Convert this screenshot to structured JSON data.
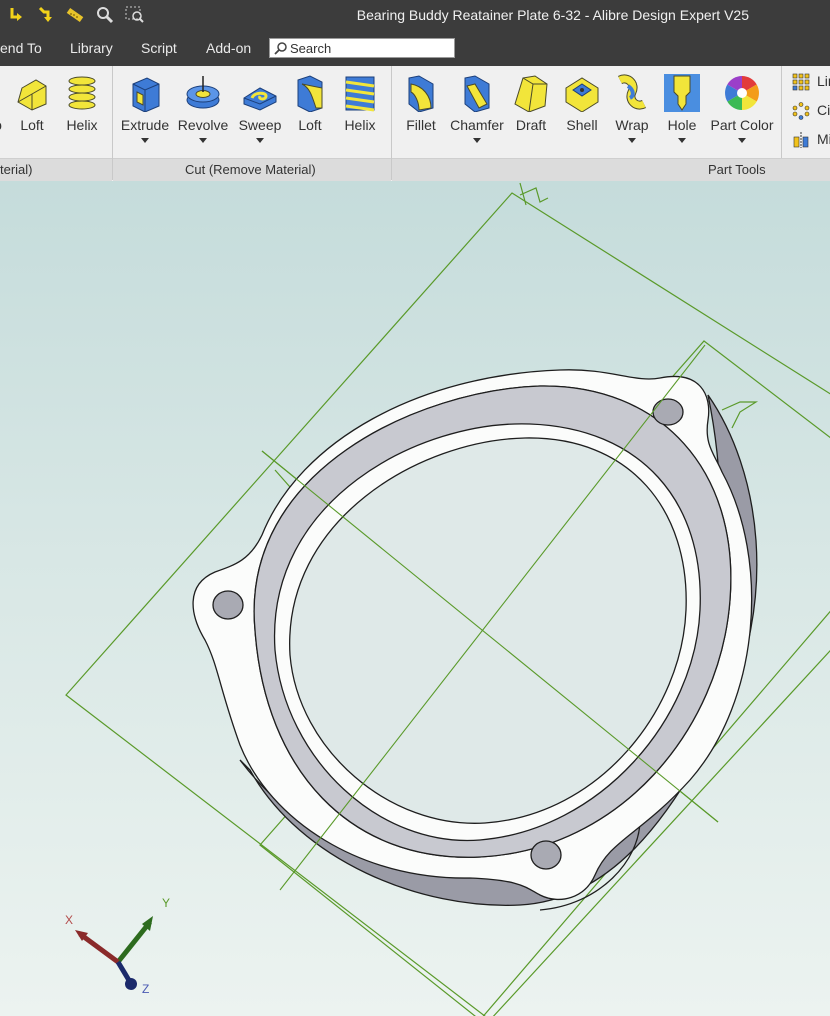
{
  "window": {
    "title": "Bearing Buddy Reatainer Plate 6-32 - Alibre Design Expert V25"
  },
  "quick_access": [
    {
      "name": "undo-arrow-icon"
    },
    {
      "name": "redo-arrow-icon"
    },
    {
      "name": "measure-ruler-icon"
    },
    {
      "name": "zoom-magnifier-icon"
    },
    {
      "name": "zoom-window-icon"
    }
  ],
  "menu": {
    "items": [
      "end To",
      "Library",
      "Script",
      "Add-on"
    ],
    "search": {
      "value": "Search"
    }
  },
  "ribbon": {
    "add_material": {
      "footer_label": "terial)",
      "tools": [
        {
          "label": "o",
          "icon": "partial-tool-icon"
        },
        {
          "label": "Loft",
          "icon": "loft-add-icon"
        },
        {
          "label": "Helix",
          "icon": "helix-add-icon"
        }
      ]
    },
    "cut": {
      "footer_label": "Cut (Remove Material)",
      "tools": [
        {
          "label": "Extrude",
          "icon": "extrude-cut-icon",
          "dropdown": true
        },
        {
          "label": "Revolve",
          "icon": "revolve-cut-icon",
          "dropdown": true
        },
        {
          "label": "Sweep",
          "icon": "sweep-cut-icon",
          "dropdown": true
        },
        {
          "label": "Loft",
          "icon": "loft-cut-icon",
          "dropdown": false
        },
        {
          "label": "Helix",
          "icon": "helix-cut-icon",
          "dropdown": false
        }
      ]
    },
    "part_tools": {
      "footer_label": "Part Tools",
      "tools": [
        {
          "label": "Fillet",
          "icon": "fillet-icon",
          "dropdown": false
        },
        {
          "label": "Chamfer",
          "icon": "chamfer-icon",
          "dropdown": true
        },
        {
          "label": "Draft",
          "icon": "draft-icon",
          "dropdown": false
        },
        {
          "label": "Shell",
          "icon": "shell-icon",
          "dropdown": false
        },
        {
          "label": "Wrap",
          "icon": "wrap-icon",
          "dropdown": true
        },
        {
          "label": "Hole",
          "icon": "hole-icon",
          "dropdown": true
        },
        {
          "label": "Part Color",
          "icon": "color-wheel-icon",
          "dropdown": true
        }
      ],
      "side": [
        {
          "label": "Lir",
          "icon": "linear-pattern-icon"
        },
        {
          "label": "Cir",
          "icon": "circular-pattern-icon"
        },
        {
          "label": "Mi",
          "icon": "mirror-icon"
        }
      ]
    }
  },
  "triad": {
    "x": "X",
    "y": "Y",
    "z": "Z"
  },
  "colors": {
    "sketch_green": "#5a9a2a",
    "titlebar": "#3c3c3c",
    "icon_blue": "#3e7bd6",
    "icon_yellow": "#f2e53a"
  }
}
